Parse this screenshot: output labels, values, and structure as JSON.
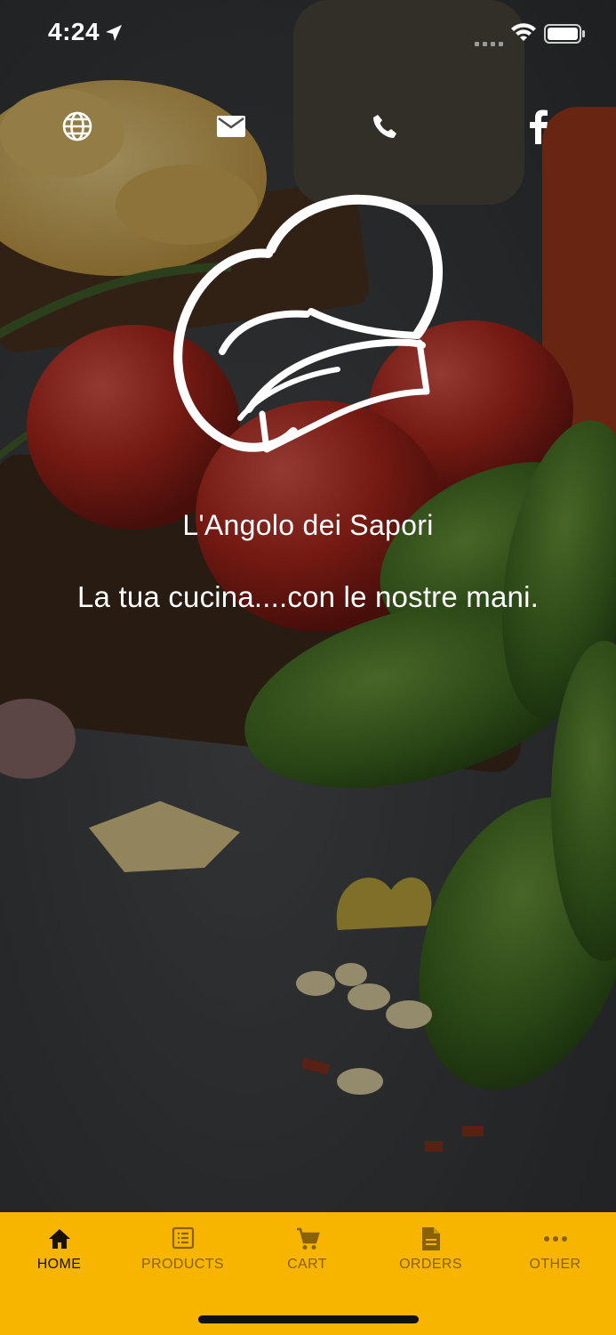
{
  "status_bar": {
    "time": "4:24"
  },
  "contact_icons": [
    {
      "icon": "globe-icon"
    },
    {
      "icon": "mail-icon"
    },
    {
      "icon": "phone-icon"
    },
    {
      "icon": "facebook-icon"
    }
  ],
  "brand": {
    "name": "L'Angolo dei Sapori",
    "tagline": "La tua cucina....con le nostre mani."
  },
  "tabs": [
    {
      "label": "HOME",
      "icon": "home-icon",
      "active": true
    },
    {
      "label": "PRODUCTS",
      "icon": "list-icon",
      "active": false
    },
    {
      "label": "CART",
      "icon": "cart-icon",
      "active": false
    },
    {
      "label": "ORDERS",
      "icon": "document-icon",
      "active": false
    },
    {
      "label": "OTHER",
      "icon": "more-icon",
      "active": false
    }
  ],
  "colors": {
    "tab_bar": "#f7b500",
    "tab_active": "#1a1200",
    "tab_inactive": "#8a6206"
  }
}
